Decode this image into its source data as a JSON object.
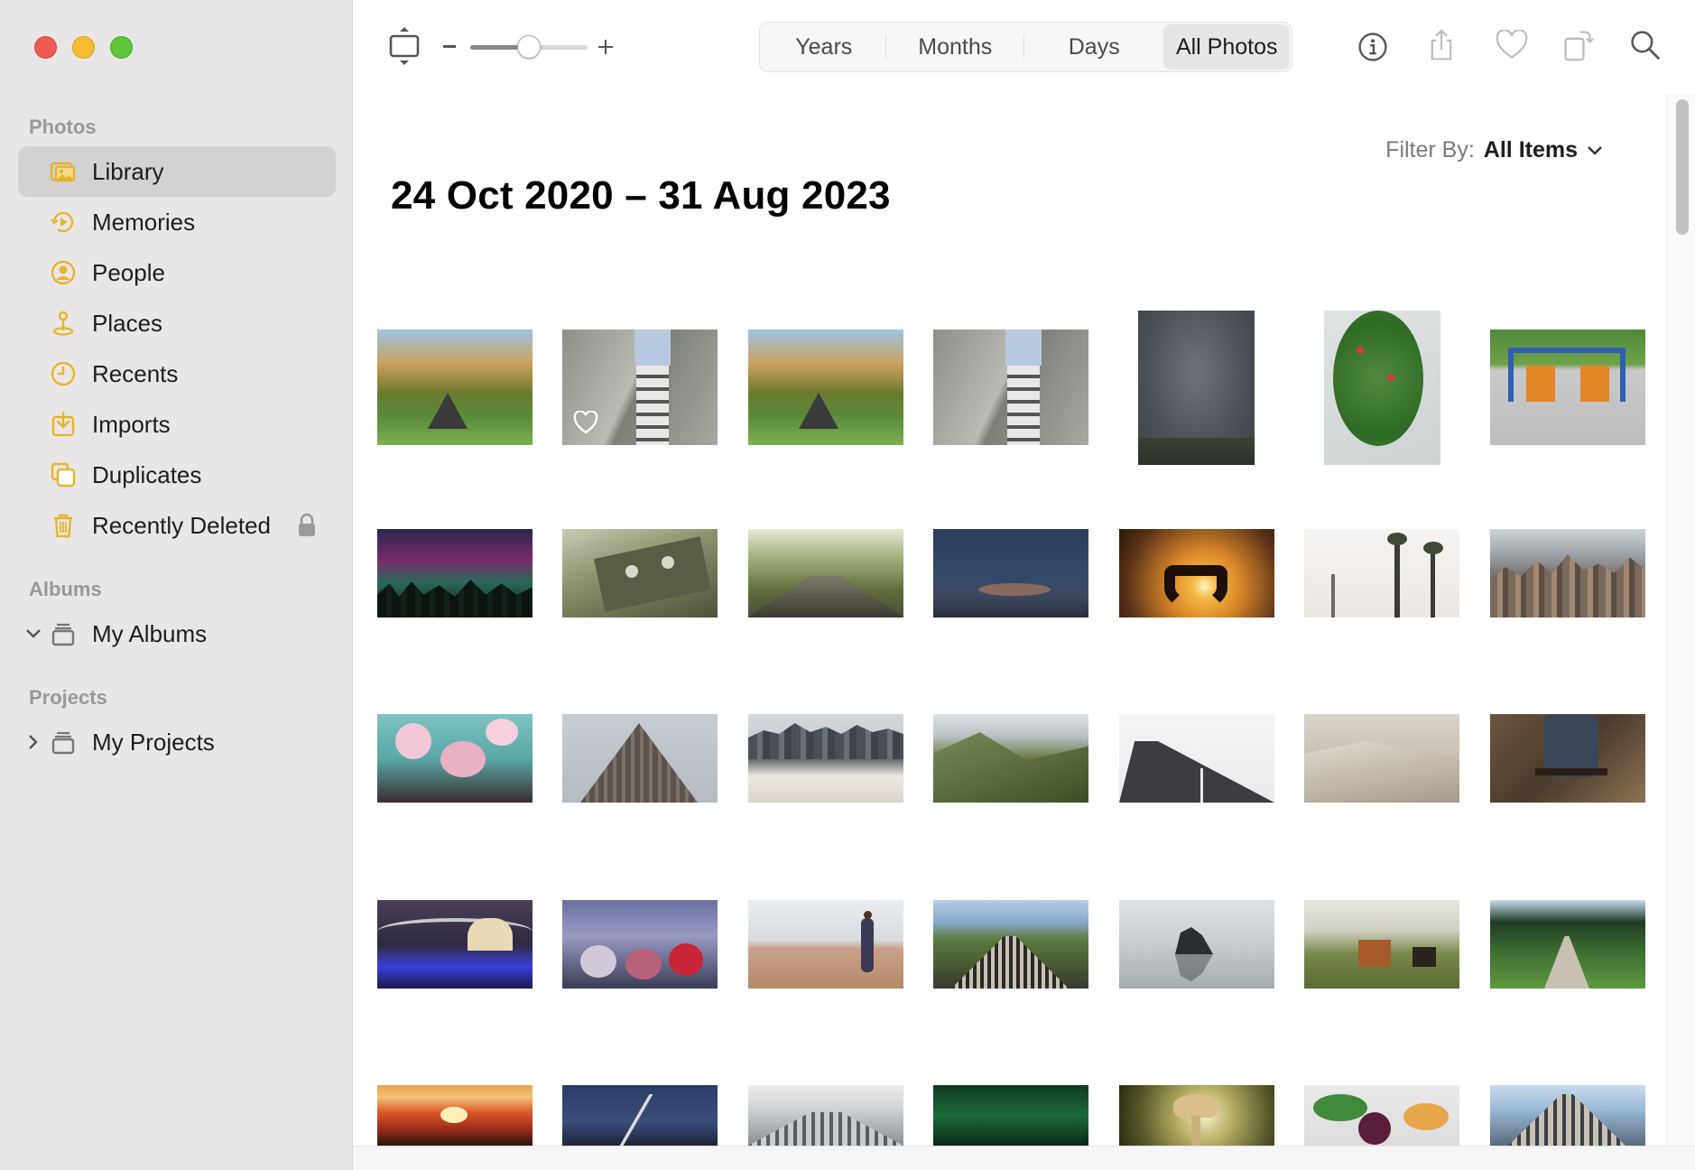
{
  "sidebar": {
    "sections": {
      "photos": "Photos",
      "albums": "Albums",
      "projects": "Projects"
    },
    "items": [
      {
        "label": "Library",
        "icon": "library-icon",
        "selected": true
      },
      {
        "label": "Memories",
        "icon": "memories-icon"
      },
      {
        "label": "People",
        "icon": "people-icon"
      },
      {
        "label": "Places",
        "icon": "places-icon"
      },
      {
        "label": "Recents",
        "icon": "recents-icon"
      },
      {
        "label": "Imports",
        "icon": "imports-icon"
      },
      {
        "label": "Duplicates",
        "icon": "duplicates-icon"
      },
      {
        "label": "Recently Deleted",
        "icon": "trash-icon",
        "locked": true
      }
    ],
    "albums": {
      "label": "My Albums",
      "expanded": true
    },
    "projects": {
      "label": "My Projects",
      "expanded": false
    }
  },
  "toolbar": {
    "zoom_level": 0.5,
    "views": [
      "Years",
      "Months",
      "Days",
      "All Photos"
    ],
    "active_view": "All Photos"
  },
  "content": {
    "filter_label": "Filter By:",
    "filter_value": "All Items",
    "date_range": "24 Oct 2020 – 31 Aug 2023"
  },
  "colors": {
    "accent": "#e6b52a",
    "sidebar_bg": "#e8e6e7",
    "selected_bg": "#d3d1d2"
  }
}
